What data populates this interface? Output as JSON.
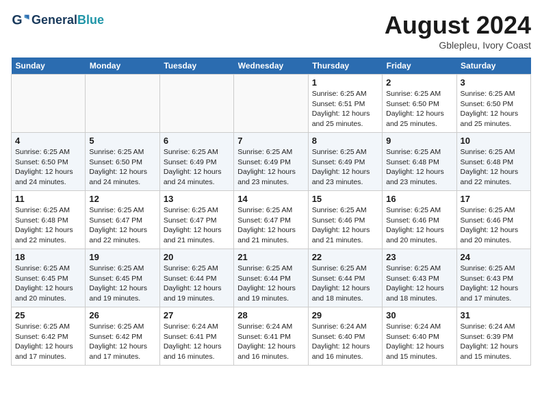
{
  "header": {
    "logo_line1": "General",
    "logo_line2": "Blue",
    "month": "August 2024",
    "location": "Gblepleu, Ivory Coast"
  },
  "weekdays": [
    "Sunday",
    "Monday",
    "Tuesday",
    "Wednesday",
    "Thursday",
    "Friday",
    "Saturday"
  ],
  "weeks": [
    [
      {
        "day": "",
        "info": ""
      },
      {
        "day": "",
        "info": ""
      },
      {
        "day": "",
        "info": ""
      },
      {
        "day": "",
        "info": ""
      },
      {
        "day": "1",
        "info": "Sunrise: 6:25 AM\nSunset: 6:51 PM\nDaylight: 12 hours\nand 25 minutes."
      },
      {
        "day": "2",
        "info": "Sunrise: 6:25 AM\nSunset: 6:50 PM\nDaylight: 12 hours\nand 25 minutes."
      },
      {
        "day": "3",
        "info": "Sunrise: 6:25 AM\nSunset: 6:50 PM\nDaylight: 12 hours\nand 25 minutes."
      }
    ],
    [
      {
        "day": "4",
        "info": "Sunrise: 6:25 AM\nSunset: 6:50 PM\nDaylight: 12 hours\nand 24 minutes."
      },
      {
        "day": "5",
        "info": "Sunrise: 6:25 AM\nSunset: 6:50 PM\nDaylight: 12 hours\nand 24 minutes."
      },
      {
        "day": "6",
        "info": "Sunrise: 6:25 AM\nSunset: 6:49 PM\nDaylight: 12 hours\nand 24 minutes."
      },
      {
        "day": "7",
        "info": "Sunrise: 6:25 AM\nSunset: 6:49 PM\nDaylight: 12 hours\nand 23 minutes."
      },
      {
        "day": "8",
        "info": "Sunrise: 6:25 AM\nSunset: 6:49 PM\nDaylight: 12 hours\nand 23 minutes."
      },
      {
        "day": "9",
        "info": "Sunrise: 6:25 AM\nSunset: 6:48 PM\nDaylight: 12 hours\nand 23 minutes."
      },
      {
        "day": "10",
        "info": "Sunrise: 6:25 AM\nSunset: 6:48 PM\nDaylight: 12 hours\nand 22 minutes."
      }
    ],
    [
      {
        "day": "11",
        "info": "Sunrise: 6:25 AM\nSunset: 6:48 PM\nDaylight: 12 hours\nand 22 minutes."
      },
      {
        "day": "12",
        "info": "Sunrise: 6:25 AM\nSunset: 6:47 PM\nDaylight: 12 hours\nand 22 minutes."
      },
      {
        "day": "13",
        "info": "Sunrise: 6:25 AM\nSunset: 6:47 PM\nDaylight: 12 hours\nand 21 minutes."
      },
      {
        "day": "14",
        "info": "Sunrise: 6:25 AM\nSunset: 6:47 PM\nDaylight: 12 hours\nand 21 minutes."
      },
      {
        "day": "15",
        "info": "Sunrise: 6:25 AM\nSunset: 6:46 PM\nDaylight: 12 hours\nand 21 minutes."
      },
      {
        "day": "16",
        "info": "Sunrise: 6:25 AM\nSunset: 6:46 PM\nDaylight: 12 hours\nand 20 minutes."
      },
      {
        "day": "17",
        "info": "Sunrise: 6:25 AM\nSunset: 6:46 PM\nDaylight: 12 hours\nand 20 minutes."
      }
    ],
    [
      {
        "day": "18",
        "info": "Sunrise: 6:25 AM\nSunset: 6:45 PM\nDaylight: 12 hours\nand 20 minutes."
      },
      {
        "day": "19",
        "info": "Sunrise: 6:25 AM\nSunset: 6:45 PM\nDaylight: 12 hours\nand 19 minutes."
      },
      {
        "day": "20",
        "info": "Sunrise: 6:25 AM\nSunset: 6:44 PM\nDaylight: 12 hours\nand 19 minutes."
      },
      {
        "day": "21",
        "info": "Sunrise: 6:25 AM\nSunset: 6:44 PM\nDaylight: 12 hours\nand 19 minutes."
      },
      {
        "day": "22",
        "info": "Sunrise: 6:25 AM\nSunset: 6:44 PM\nDaylight: 12 hours\nand 18 minutes."
      },
      {
        "day": "23",
        "info": "Sunrise: 6:25 AM\nSunset: 6:43 PM\nDaylight: 12 hours\nand 18 minutes."
      },
      {
        "day": "24",
        "info": "Sunrise: 6:25 AM\nSunset: 6:43 PM\nDaylight: 12 hours\nand 17 minutes."
      }
    ],
    [
      {
        "day": "25",
        "info": "Sunrise: 6:25 AM\nSunset: 6:42 PM\nDaylight: 12 hours\nand 17 minutes."
      },
      {
        "day": "26",
        "info": "Sunrise: 6:25 AM\nSunset: 6:42 PM\nDaylight: 12 hours\nand 17 minutes."
      },
      {
        "day": "27",
        "info": "Sunrise: 6:24 AM\nSunset: 6:41 PM\nDaylight: 12 hours\nand 16 minutes."
      },
      {
        "day": "28",
        "info": "Sunrise: 6:24 AM\nSunset: 6:41 PM\nDaylight: 12 hours\nand 16 minutes."
      },
      {
        "day": "29",
        "info": "Sunrise: 6:24 AM\nSunset: 6:40 PM\nDaylight: 12 hours\nand 16 minutes."
      },
      {
        "day": "30",
        "info": "Sunrise: 6:24 AM\nSunset: 6:40 PM\nDaylight: 12 hours\nand 15 minutes."
      },
      {
        "day": "31",
        "info": "Sunrise: 6:24 AM\nSunset: 6:39 PM\nDaylight: 12 hours\nand 15 minutes."
      }
    ]
  ]
}
